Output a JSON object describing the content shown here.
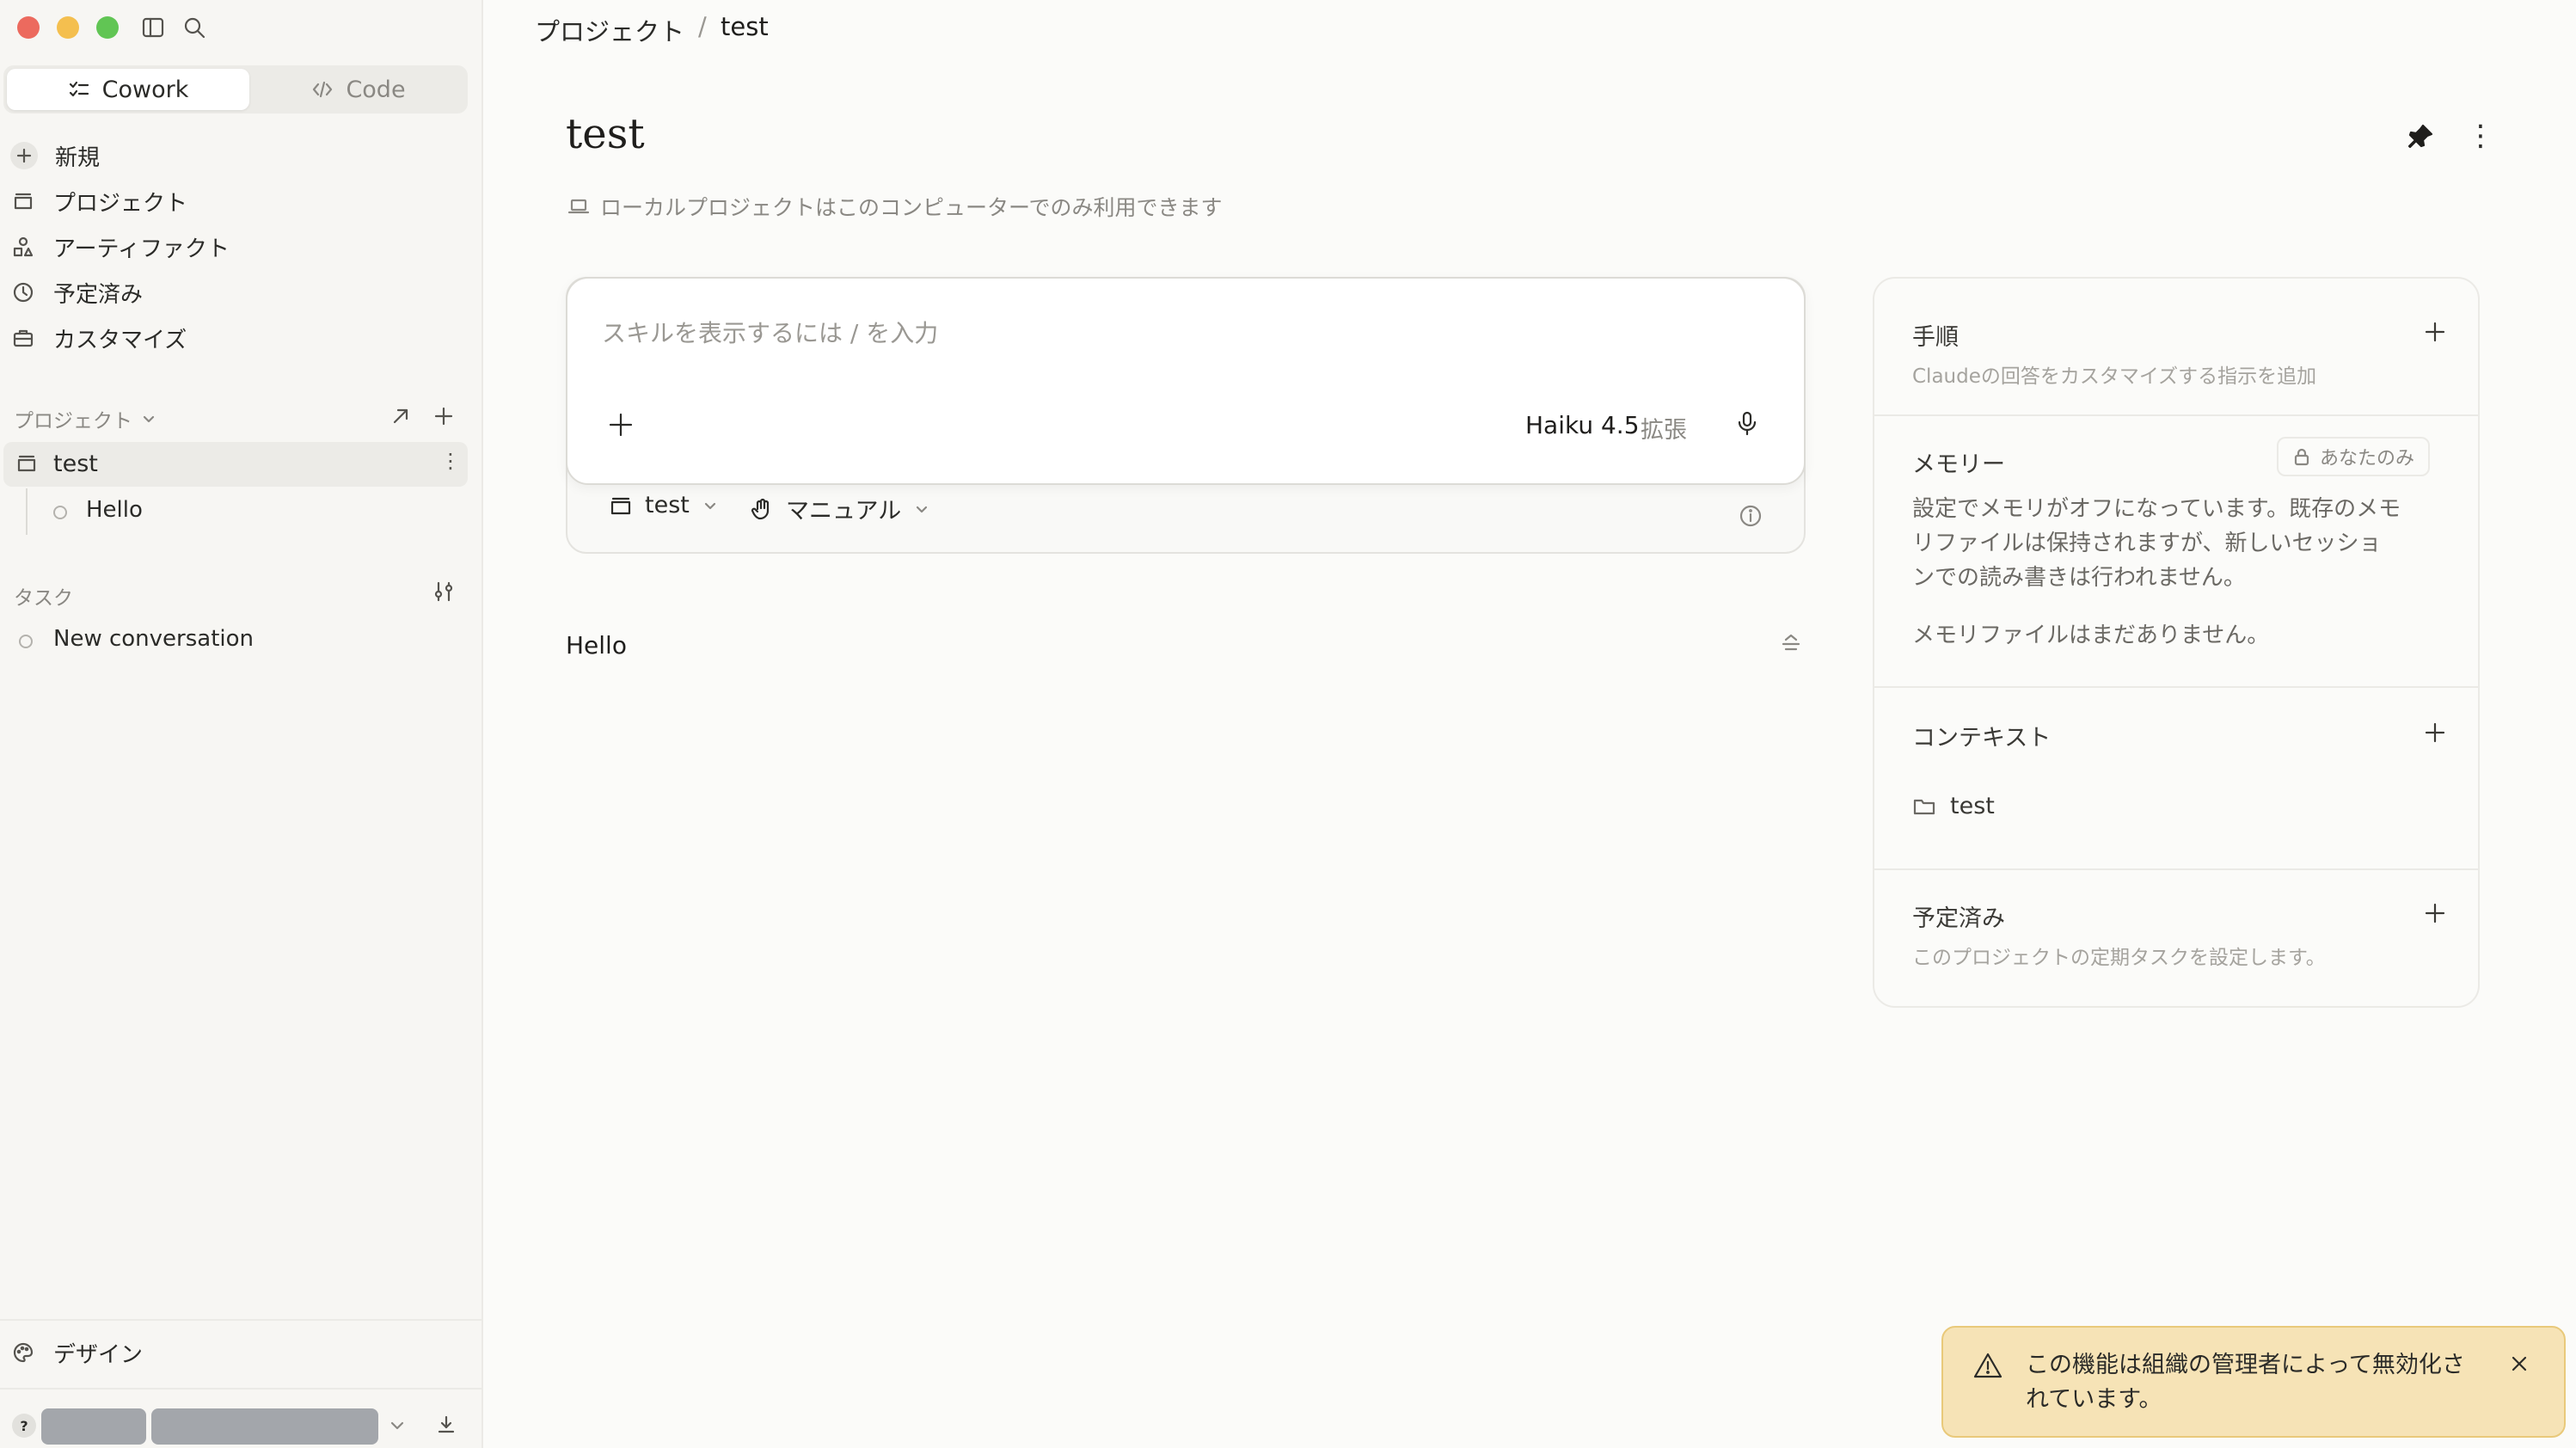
{
  "sidebar": {
    "modes": [
      "Cowork",
      "Code"
    ],
    "nav": [
      {
        "label": "新規",
        "icon": "plus-icon"
      },
      {
        "label": "プロジェクト",
        "icon": "folder-icon"
      },
      {
        "label": "アーティファクト",
        "icon": "shapes-icon"
      },
      {
        "label": "予定済み",
        "icon": "clock-icon"
      },
      {
        "label": "カスタマイズ",
        "icon": "briefcase-icon"
      }
    ],
    "projects_label": "プロジェクト",
    "project": "test",
    "project_child": "Hello",
    "tasks_label": "タスク",
    "task_item": "New conversation",
    "design_label": "デザイン",
    "help_label": "?"
  },
  "breadcrumb": {
    "parent": "プロジェクト",
    "separator": "/",
    "current": "test"
  },
  "main": {
    "title": "test",
    "subtitle": "ローカルプロジェクトはこのコンピューターでのみ利用できます",
    "composer": {
      "placeholder": "スキルを表示するには / を入力",
      "model": "Haiku 4.5",
      "mode": "拡張"
    },
    "toolbar": {
      "project": "test",
      "permission": "マニュアル"
    },
    "message": "Hello"
  },
  "panel": {
    "instructions": {
      "title": "手順",
      "desc": "Claudeの回答をカスタマイズする指示を追加"
    },
    "memory": {
      "title": "メモリー",
      "badge": "あなたのみ",
      "text1a": "設定でメモリがオフになっています。既存のメモ",
      "text1b": "リファイルは保持されますが、新しいセッショ",
      "text1c": "ンでの読み書きは行われません。",
      "text2": "メモリファイルはまだありません。"
    },
    "context": {
      "title": "コンテキスト",
      "item": "test"
    },
    "scheduled": {
      "title": "予定済み",
      "desc": "このプロジェクトの定期タスクを設定します。"
    }
  },
  "toast": {
    "line1": "この機能は組織の管理者によって無効化さ",
    "line2": "れています。"
  },
  "colors": {
    "toast_bg": "#f6e3b6",
    "toast_border": "#e9c97a",
    "close_red": "#ec6a5e",
    "min_yellow": "#f4bf4f",
    "max_green": "#61c554"
  }
}
